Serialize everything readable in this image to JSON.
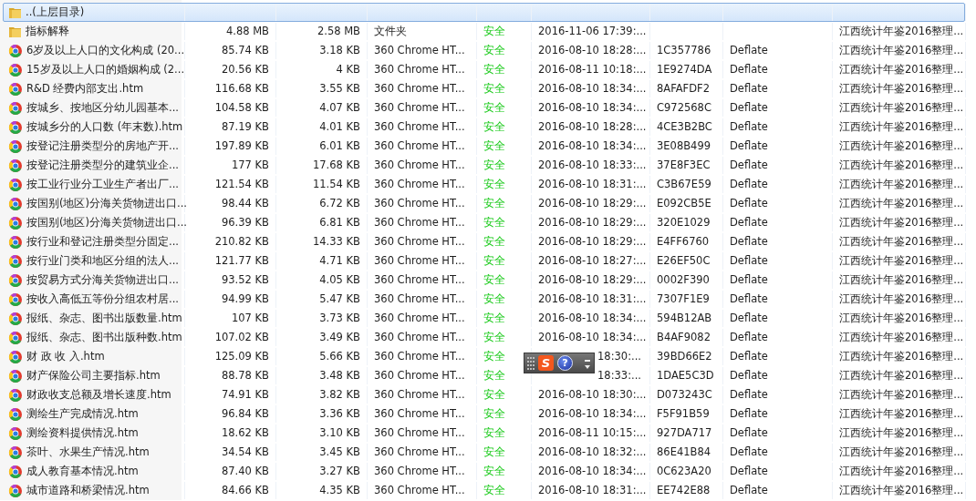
{
  "files": [
    {
      "kind": "parent",
      "name": "..(上层目录)",
      "selected": true
    },
    {
      "kind": "folder",
      "name": "指标解释",
      "size": "4.88 MB",
      "packed": "2.58 MB",
      "type": "文件夹",
      "safety": "安全",
      "modified": "2016-11-06 17:39:...",
      "path": "江西统计年鉴2016整理...",
      "selected": false
    },
    {
      "kind": "htm",
      "name": "6岁及以上人口的文化构成 (20...",
      "size": "85.74 KB",
      "packed": "3.18 KB",
      "type": "360 Chrome HT...",
      "safety": "安全",
      "modified": "2016-08-10 18:28:...",
      "crc": "1C357786",
      "method": "Deflate",
      "path": "江西统计年鉴2016整理...",
      "selected": false
    },
    {
      "kind": "htm",
      "name": "15岁及以上人口的婚姻构成 (2...",
      "size": "20.56 KB",
      "packed": "4 KB",
      "type": "360 Chrome HT...",
      "safety": "安全",
      "modified": "2016-08-11 10:18:...",
      "crc": "1E9274DA",
      "method": "Deflate",
      "path": "江西统计年鉴2016整理...",
      "selected": false
    },
    {
      "kind": "htm",
      "name": "R&D 经费内部支出.htm",
      "size": "116.68 KB",
      "packed": "3.55 KB",
      "type": "360 Chrome HT...",
      "safety": "安全",
      "modified": "2016-08-10 18:34:...",
      "crc": "8AFAFDF2",
      "method": "Deflate",
      "path": "江西统计年鉴2016整理...",
      "selected": false
    },
    {
      "kind": "htm",
      "name": "按城乡、按地区分幼儿园基本...",
      "size": "104.58 KB",
      "packed": "4.07 KB",
      "type": "360 Chrome HT...",
      "safety": "安全",
      "modified": "2016-08-10 18:34:...",
      "crc": "C972568C",
      "method": "Deflate",
      "path": "江西统计年鉴2016整理...",
      "selected": false
    },
    {
      "kind": "htm",
      "name": "按城乡分的人口数 (年末数).htm",
      "size": "87.19 KB",
      "packed": "4.01 KB",
      "type": "360 Chrome HT...",
      "safety": "安全",
      "modified": "2016-08-10 18:28:...",
      "crc": "4CE3B2BC",
      "method": "Deflate",
      "path": "江西统计年鉴2016整理...",
      "selected": false
    },
    {
      "kind": "htm",
      "name": "按登记注册类型分的房地产开...",
      "size": "197.89 KB",
      "packed": "6.01 KB",
      "type": "360 Chrome HT...",
      "safety": "安全",
      "modified": "2016-08-10 18:34:...",
      "crc": "3E08B499",
      "method": "Deflate",
      "path": "江西统计年鉴2016整理...",
      "selected": false
    },
    {
      "kind": "htm",
      "name": "按登记注册类型分的建筑业企...",
      "size": "177 KB",
      "packed": "17.68 KB",
      "type": "360 Chrome HT...",
      "safety": "安全",
      "modified": "2016-08-10 18:33:...",
      "crc": "37E8F3EC",
      "method": "Deflate",
      "path": "江西统计年鉴2016整理...",
      "selected": false
    },
    {
      "kind": "htm",
      "name": "按工业行业分工业生产者出厂...",
      "size": "121.54 KB",
      "packed": "11.54 KB",
      "type": "360 Chrome HT...",
      "safety": "安全",
      "modified": "2016-08-10 18:31:...",
      "crc": "C3B67E59",
      "method": "Deflate",
      "path": "江西统计年鉴2016整理...",
      "selected": false
    },
    {
      "kind": "htm",
      "name": "按国别(地区)分海关货物进出口...",
      "size": "98.44 KB",
      "packed": "6.72 KB",
      "type": "360 Chrome HT...",
      "safety": "安全",
      "modified": "2016-08-10 18:29:...",
      "crc": "E092CB5E",
      "method": "Deflate",
      "path": "江西统计年鉴2016整理...",
      "selected": false
    },
    {
      "kind": "htm",
      "name": "按国别(地区)分海关货物进出口...",
      "size": "96.39 KB",
      "packed": "6.81 KB",
      "type": "360 Chrome HT...",
      "safety": "安全",
      "modified": "2016-08-10 18:29:...",
      "crc": "320E1029",
      "method": "Deflate",
      "path": "江西统计年鉴2016整理...",
      "selected": false
    },
    {
      "kind": "htm",
      "name": "按行业和登记注册类型分固定...",
      "size": "210.82 KB",
      "packed": "14.33 KB",
      "type": "360 Chrome HT...",
      "safety": "安全",
      "modified": "2016-08-10 18:29:...",
      "crc": "E4FF6760",
      "method": "Deflate",
      "path": "江西统计年鉴2016整理...",
      "selected": false
    },
    {
      "kind": "htm",
      "name": "按行业门类和地区分组的法人...",
      "size": "121.77 KB",
      "packed": "4.71 KB",
      "type": "360 Chrome HT...",
      "safety": "安全",
      "modified": "2016-08-10 18:27:...",
      "crc": "E26EF50C",
      "method": "Deflate",
      "path": "江西统计年鉴2016整理...",
      "selected": false
    },
    {
      "kind": "htm",
      "name": "按贸易方式分海关货物进出口...",
      "size": "93.52 KB",
      "packed": "4.05 KB",
      "type": "360 Chrome HT...",
      "safety": "安全",
      "modified": "2016-08-10 18:29:...",
      "crc": "0002F390",
      "method": "Deflate",
      "path": "江西统计年鉴2016整理...",
      "selected": false
    },
    {
      "kind": "htm",
      "name": "按收入高低五等份分组农村居...",
      "size": "94.99 KB",
      "packed": "5.47 KB",
      "type": "360 Chrome HT...",
      "safety": "安全",
      "modified": "2016-08-10 18:31:...",
      "crc": "7307F1E9",
      "method": "Deflate",
      "path": "江西统计年鉴2016整理...",
      "selected": false
    },
    {
      "kind": "htm",
      "name": "报纸、杂志、图书出版数量.htm",
      "size": "107 KB",
      "packed": "3.73 KB",
      "type": "360 Chrome HT...",
      "safety": "安全",
      "modified": "2016-08-10 18:34:...",
      "crc": "594B12AB",
      "method": "Deflate",
      "path": "江西统计年鉴2016整理...",
      "selected": false
    },
    {
      "kind": "htm",
      "name": "报纸、杂志、图书出版种数.htm",
      "size": "107.02 KB",
      "packed": "3.49 KB",
      "type": "360 Chrome HT...",
      "safety": "安全",
      "modified": "2016-08-10 18:34:...",
      "crc": "B4AF9082",
      "method": "Deflate",
      "path": "江西统计年鉴2016整理...",
      "selected": false
    },
    {
      "kind": "htm",
      "name": "财 政 收 入.htm",
      "size": "125.09 KB",
      "packed": "5.66 KB",
      "type": "360 Chrome HT...",
      "safety": "安全",
      "modified": "18:30:...",
      "modified_partly_covered": true,
      "crc": "39BD66E2",
      "method": "Deflate",
      "path": "江西统计年鉴2016整理...",
      "selected": false
    },
    {
      "kind": "htm",
      "name": "财产保险公司主要指标.htm",
      "size": "88.78 KB",
      "packed": "3.48 KB",
      "type": "360 Chrome HT...",
      "safety": "安全",
      "modified": "18:33:...",
      "modified_partly_covered": true,
      "crc": "1DAE5C3D",
      "method": "Deflate",
      "path": "江西统计年鉴2016整理...",
      "selected": false
    },
    {
      "kind": "htm",
      "name": "财政收支总额及增长速度.htm",
      "size": "74.91 KB",
      "packed": "3.82 KB",
      "type": "360 Chrome HT...",
      "safety": "安全",
      "modified": "2016-08-10 18:30:...",
      "crc": "D073243C",
      "method": "Deflate",
      "path": "江西统计年鉴2016整理...",
      "selected": false
    },
    {
      "kind": "htm",
      "name": "测绘生产完成情况.htm",
      "size": "96.84 KB",
      "packed": "3.36 KB",
      "type": "360 Chrome HT...",
      "safety": "安全",
      "modified": "2016-08-10 18:34:...",
      "crc": "F5F91B59",
      "method": "Deflate",
      "path": "江西统计年鉴2016整理...",
      "selected": false
    },
    {
      "kind": "htm",
      "name": "测绘资料提供情况.htm",
      "size": "18.62 KB",
      "packed": "3.10 KB",
      "type": "360 Chrome HT...",
      "safety": "安全",
      "modified": "2016-08-11 10:15:...",
      "crc": "927DA717",
      "method": "Deflate",
      "path": "江西统计年鉴2016整理...",
      "selected": false
    },
    {
      "kind": "htm",
      "name": "茶叶、水果生产情况.htm",
      "size": "34.54 KB",
      "packed": "3.45 KB",
      "type": "360 Chrome HT...",
      "safety": "安全",
      "modified": "2016-08-10 18:32:...",
      "crc": "86E41B84",
      "method": "Deflate",
      "path": "江西统计年鉴2016整理...",
      "selected": false
    },
    {
      "kind": "htm",
      "name": "成人教育基本情况.htm",
      "size": "87.40 KB",
      "packed": "3.27 KB",
      "type": "360 Chrome HT...",
      "safety": "安全",
      "modified": "2016-08-10 18:34:...",
      "crc": "0C623A20",
      "method": "Deflate",
      "path": "江西统计年鉴2016整理...",
      "selected": false
    },
    {
      "kind": "htm",
      "name": "城市道路和桥梁情况.htm",
      "size": "84.66 KB",
      "packed": "4.35 KB",
      "type": "360 Chrome HT...",
      "safety": "安全",
      "modified": "2016-08-10 18:31:...",
      "crc": "EE742E88",
      "method": "Deflate",
      "path": "江西统计年鉴2016整理...",
      "selected": false
    }
  ],
  "ime_toolbar": {
    "logo": "S",
    "help": "?"
  }
}
